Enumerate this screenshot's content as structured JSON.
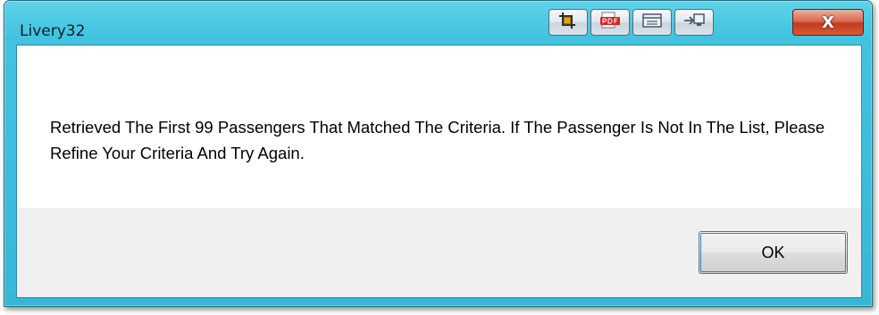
{
  "window": {
    "title": "Livery32",
    "close_label": "X",
    "toolbar_icons": [
      "crop-icon",
      "pdf-icon",
      "screen-capture-icon",
      "send-to-icon"
    ]
  },
  "dialog": {
    "message": "Retrieved The First 99 Passengers That Matched The Criteria.  If The Passenger Is Not In The List, Please Refine Your Criteria And Try Again.",
    "ok_label": "OK"
  },
  "colors": {
    "titlebar": "#41c3e0",
    "close_button": "#c23a1f",
    "client_bg": "#f0f0f0",
    "message_bg": "#ffffff"
  }
}
